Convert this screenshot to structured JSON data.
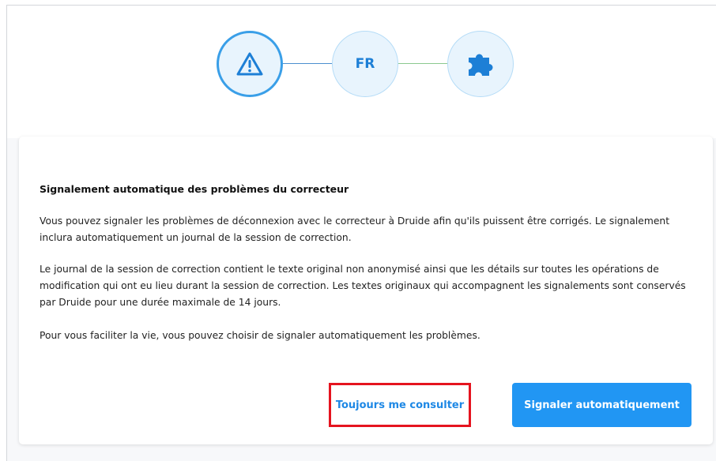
{
  "stepper": {
    "step1_icon": "warning-triangle-icon",
    "step2_label": "FR",
    "step3_icon": "puzzle-piece-icon",
    "accent_color": "#2196f3"
  },
  "dialog": {
    "title": "Signalement automatique des problèmes du correcteur",
    "paragraph1": "Vous pouvez signaler les problèmes de déconnexion avec le correcteur à Druide afin qu'ils puissent être corrigés. Le signalement inclura automatiquement un journal de la session de correction.",
    "paragraph2": "Le journal de la session de correction contient le texte original non anonymisé ainsi que les détails sur toutes les opérations de modification qui ont eu lieu durant la session de correction. Les textes originaux qui accompagnent les signalements sont conservés par Druide pour une durée maximale de 14 jours.",
    "paragraph3": "Pour vous faciliter la vie, vous pouvez choisir de signaler automatiquement les problèmes."
  },
  "buttons": {
    "always_ask": "Toujours me consulter",
    "auto_report": "Signaler automatiquement"
  }
}
